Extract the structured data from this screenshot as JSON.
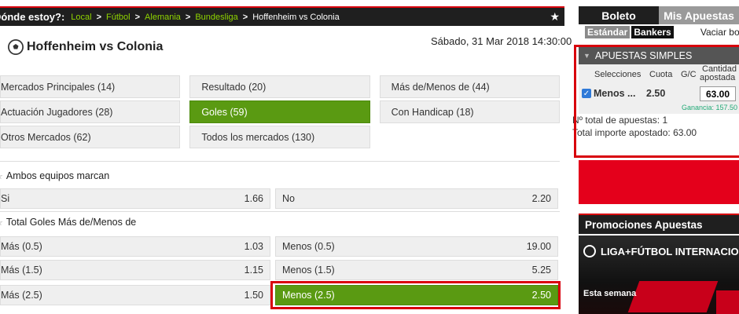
{
  "breadcrumb": {
    "question": "Dónde estoy?:",
    "links": [
      "Local",
      "Fútbol",
      "Alemania",
      "Bundesliga"
    ],
    "separator": ">",
    "current": "Hoffenheim vs Colonia"
  },
  "match": {
    "title": "Hoffenheim vs Colonia",
    "date": "Sábado, 31 Mar 2018 14:30:00"
  },
  "markets": [
    [
      {
        "label": "Mercados Principales (14)",
        "active": false
      },
      {
        "label": "Resultado (20)",
        "active": false
      },
      {
        "label": "Más de/Menos de (44)",
        "active": false
      }
    ],
    [
      {
        "label": "Actuación Jugadores (28)",
        "active": false
      },
      {
        "label": "Goles (59)",
        "active": true
      },
      {
        "label": "Con Handicap (18)",
        "active": false
      }
    ],
    [
      {
        "label": "Otros Mercados (62)",
        "active": false
      },
      {
        "label": "Todos los mercados (130)",
        "active": false
      }
    ]
  ],
  "sections": {
    "ambos": {
      "title": "Ambos equipos marcan",
      "left": {
        "label": "Si",
        "odd": "1.66"
      },
      "right": {
        "label": "No",
        "odd": "2.20"
      }
    },
    "total": {
      "title": "Total Goles Más de/Menos de",
      "rows": [
        {
          "left": {
            "label": "Más (0.5)",
            "odd": "1.03"
          },
          "right": {
            "label": "Menos (0.5)",
            "odd": "19.00"
          }
        },
        {
          "left": {
            "label": "Más (1.5)",
            "odd": "1.15"
          },
          "right": {
            "label": "Menos (1.5)",
            "odd": "5.25"
          }
        },
        {
          "left": {
            "label": "Más (2.5)",
            "odd": "1.50"
          },
          "right": {
            "label": "Menos (2.5)",
            "odd": "2.50"
          }
        }
      ]
    }
  },
  "sidebar": {
    "tabs": [
      "Boleto",
      "Mis Apuestas"
    ],
    "subtabs": [
      "Estándar",
      "Bankers"
    ],
    "vaciar": "Vaciar boleto",
    "slip": {
      "header": "APUESTAS SIMPLES",
      "columns": {
        "selecciones": "Selecciones",
        "cuota": "Cuota",
        "gc": "G/C",
        "cantidad_1": "Cantidad",
        "cantidad_2": "apostada"
      },
      "line": {
        "name": "Menos ...",
        "odd": "2.50",
        "stake": "63.00"
      },
      "ganancia": "Ganancia: 157.50",
      "total_bets": "Nº total de apuestas: 1",
      "total_amount": "Total importe apostado: 63.00"
    },
    "promo": {
      "title": "Promociones Apuestas",
      "banner_title": "LIGA+FÚTBOL INTERNACIONAL",
      "banner_sub": "Esta semana"
    }
  },
  "colors": {
    "accent_green": "#5a9a12",
    "highlight_red": "#d8000c",
    "dark": "#1f1f1f"
  }
}
